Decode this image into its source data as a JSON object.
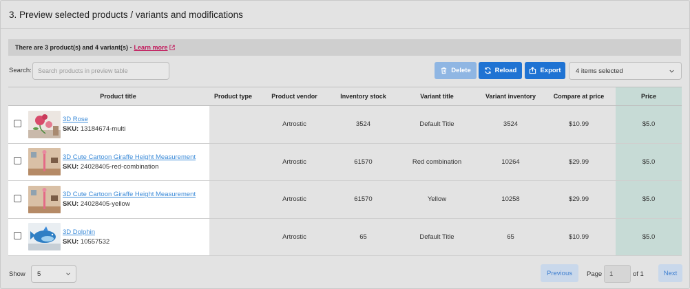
{
  "section_title": "3. Preview selected products / variants and modifications",
  "notice": {
    "text": "There are 3 product(s) and 4 variant(s) -",
    "link": "Learn more",
    "link_color": "#c2185b"
  },
  "toolbar": {
    "search_label": "Search:",
    "search_placeholder": "Search products in preview table",
    "search_value": "",
    "delete_label": "Delete",
    "reload_label": "Reload",
    "export_label": "Export",
    "selection": "4 items selected"
  },
  "table": {
    "columns": [
      "Product title",
      "Product type",
      "Product vendor",
      "Inventory stock",
      "Variant title",
      "Variant inventory",
      "Compare at price",
      "Price"
    ],
    "rows": [
      {
        "title": "3D Rose",
        "sku_label": "SKU:",
        "sku": "13184674-multi",
        "type": "",
        "vendor": "Artrostic",
        "stock": "3524",
        "variant": "Default Title",
        "variant_inventory": "3524",
        "compare_price": "$10.99",
        "price": "$5.0",
        "image": "rose"
      },
      {
        "title": "3D Cute Cartoon Giraffe Height Measurement",
        "sku_label": "SKU:",
        "sku": "24028405-red-combination",
        "type": "",
        "vendor": "Artrostic",
        "stock": "61570",
        "variant": "Red combination",
        "variant_inventory": "10264",
        "compare_price": "$29.99",
        "price": "$5.0",
        "image": "giraffe"
      },
      {
        "title": "3D Cute Cartoon Giraffe Height Measurement",
        "sku_label": "SKU:",
        "sku": "24028405-yellow",
        "type": "",
        "vendor": "Artrostic",
        "stock": "61570",
        "variant": "Yellow",
        "variant_inventory": "10258",
        "compare_price": "$29.99",
        "price": "$5.0",
        "image": "giraffe"
      },
      {
        "title": "3D Dolphin",
        "sku_label": "SKU:",
        "sku": "10557532",
        "type": "",
        "vendor": "Artrostic",
        "stock": "65",
        "variant": "Default Title",
        "variant_inventory": "65",
        "compare_price": "$10.99",
        "price": "$5.0",
        "image": "dolphin"
      }
    ]
  },
  "footer": {
    "show_label": "Show",
    "page_size": "5",
    "previous_label": "Previous",
    "page_label": "Page",
    "page_value": "1",
    "of_label": "of 1",
    "next_label": "Next"
  },
  "colors": {
    "primary_button": "#1f73d3",
    "disabled_button": "#8fb6e3",
    "price_column": "#c7dbd6",
    "link": "#3a8ad8"
  },
  "icons": {
    "delete": "trash-icon",
    "reload": "refresh-icon",
    "export": "export-icon",
    "external_link": "external-link-icon",
    "select": "chevron-down-icon"
  }
}
